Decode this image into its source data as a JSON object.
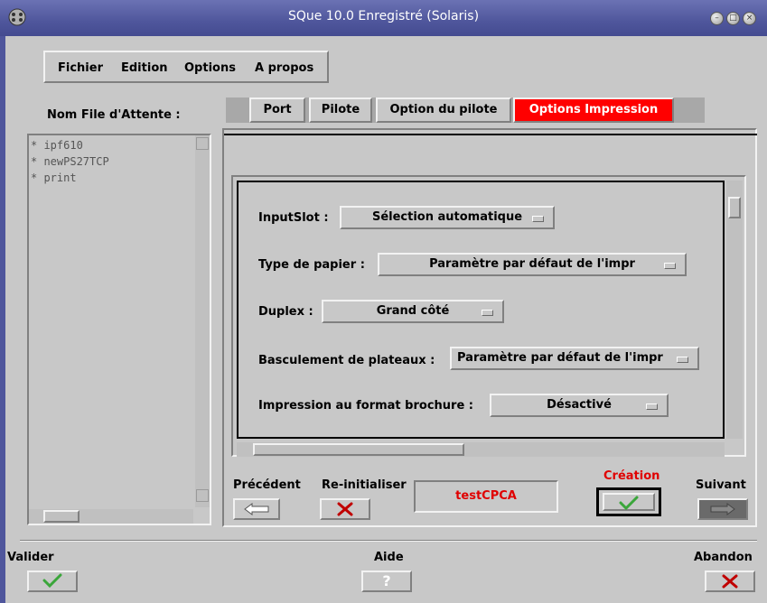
{
  "window": {
    "title": "SQue 10.0 Enregistré (Solaris)"
  },
  "menu": {
    "items": [
      "Fichier",
      "Edition",
      "Options",
      "A propos"
    ]
  },
  "queue": {
    "label": "Nom File d'Attente :",
    "items": [
      "* ipf610",
      "* newPS27TCP",
      "* print"
    ]
  },
  "tabs": [
    {
      "label": "Port",
      "active": false
    },
    {
      "label": "Pilote",
      "active": false
    },
    {
      "label": "Option du pilote",
      "active": false
    },
    {
      "label": "Options Impression",
      "active": true
    }
  ],
  "options": {
    "inputslot": {
      "label": "InputSlot :",
      "value": "Sélection automatique"
    },
    "paper_type": {
      "label": "Type de papier :",
      "value": "Paramètre par défaut de l'impr"
    },
    "duplex": {
      "label": "Duplex :",
      "value": "Grand côté"
    },
    "tray_switch": {
      "label": "Basculement de plateaux :",
      "value": "Paramètre par défaut de l'impr"
    },
    "booklet": {
      "label": "Impression au format brochure :",
      "value": "Désactivé"
    }
  },
  "nav": {
    "previous_label": "Précédent",
    "reset_label": "Re-initialiser",
    "name_value": "testCPCA",
    "create_label": "Création",
    "next_label": "Suivant"
  },
  "footer": {
    "validate_label": "Valider",
    "help_label": "Aide",
    "cancel_label": "Abandon"
  },
  "colors": {
    "titlebar": "#4f569c",
    "active_tab": "#ff0000",
    "accent_text": "#e00000",
    "check_green": "#3aa63a"
  },
  "icons": [
    "window-menu-icon",
    "minimize-icon",
    "maximize-icon",
    "close-icon",
    "arrow-left-icon",
    "x-icon",
    "check-icon",
    "arrow-right-icon",
    "question-icon"
  ]
}
